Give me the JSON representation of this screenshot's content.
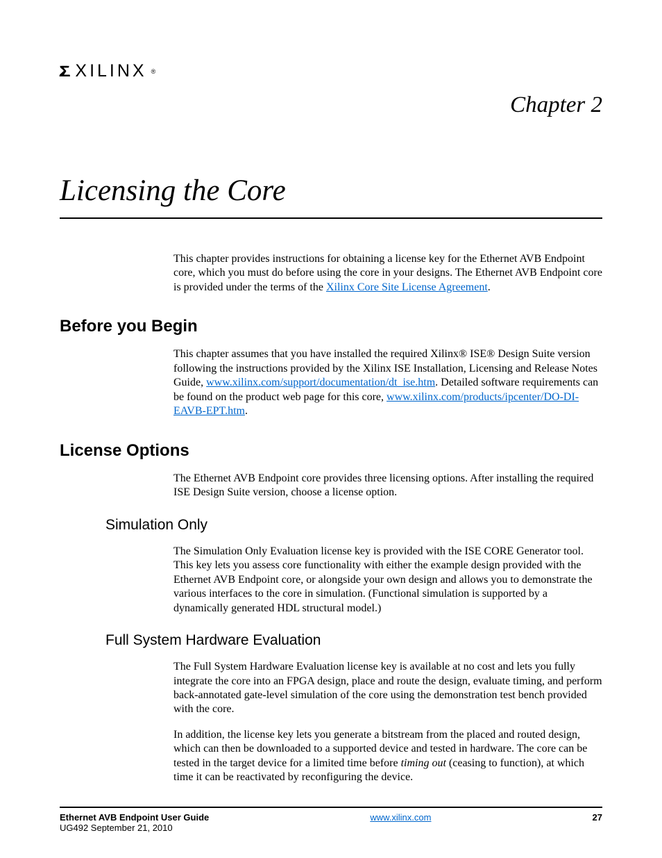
{
  "logo": {
    "text": "XILINX",
    "reg": "®"
  },
  "chapter": "Chapter 2",
  "title": "Licensing the Core",
  "intro": {
    "p1a": "This chapter provides instructions for obtaining a license key for the Ethernet AVB Endpoint core, which you must do before using the core in your designs. The Ethernet AVB Endpoint core is provided under the terms of the ",
    "link1": "Xilinx Core Site License Agreement",
    "p1b": "."
  },
  "sections": {
    "before": {
      "heading": "Before you Begin",
      "p1a": "This chapter assumes that you have installed the required Xilinx® ISE® Design Suite version following the instructions provided by the Xilinx ISE Installation, Licensing and Release Notes Guide, ",
      "link1": "www.xilinx.com/support/documentation/dt_ise.htm",
      "p1b": ". Detailed software requirements can be found on the product web page for this core, ",
      "link2": "www.xilinx.com/products/ipcenter/DO-DI-EAVB-EPT.htm",
      "p1c": "."
    },
    "license": {
      "heading": "License Options",
      "intro": "The Ethernet AVB Endpoint core provides three licensing options. After installing the required ISE Design Suite version, choose a license option.",
      "sim": {
        "heading": "Simulation Only",
        "p1": "The Simulation Only Evaluation license key is provided with the ISE CORE Generator tool. This key lets you assess core functionality with either the example design provided with the Ethernet AVB Endpoint core, or alongside your own design and allows you to demonstrate the various interfaces to the core in simulation. (Functional simulation is supported by a dynamically generated HDL structural model.)"
      },
      "hw": {
        "heading": "Full System Hardware Evaluation",
        "p1": "The Full System Hardware Evaluation license key is available at no cost and lets you fully integrate the core into an FPGA design, place and route the design, evaluate timing, and perform back-annotated gate-level simulation of the core using the demonstration test bench provided with the core.",
        "p2a": "In addition, the license key lets you generate a bitstream from the placed and routed design, which can then be downloaded to a supported device and tested in hardware. The core can be tested in the target device for a limited time before ",
        "p2italic": "timing out",
        "p2b": " (ceasing to function), at which time it can be reactivated by reconfiguring the device."
      }
    }
  },
  "footer": {
    "guide": "Ethernet AVB Endpoint User Guide",
    "doc": "UG492 September 21, 2010",
    "site": "www.xilinx.com",
    "page": "27"
  }
}
